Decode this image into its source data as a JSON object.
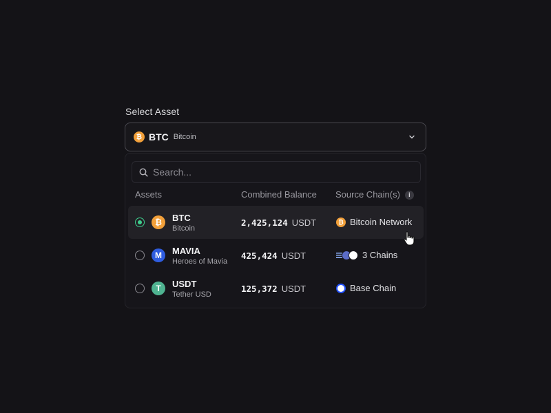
{
  "label": "Select Asset",
  "selected": {
    "symbol": "BTC",
    "name": "Bitcoin",
    "icon": "bitcoin-icon",
    "icon_glyph": "₿"
  },
  "search": {
    "placeholder": "Search..."
  },
  "columns": {
    "assets": "Assets",
    "balance": "Combined Balance",
    "chains": "Source Chain(s)",
    "info_glyph": "i"
  },
  "rows": [
    {
      "symbol": "BTC",
      "name": "Bitcoin",
      "glyph": "₿",
      "balance": "2,425,124",
      "unit": "USDT",
      "chain": "Bitcoin Network",
      "selected": true
    },
    {
      "symbol": "MAVIA",
      "name": "Heroes of Mavia",
      "glyph": "M",
      "balance": "425,424",
      "unit": "USDT",
      "chain": "3 Chains",
      "selected": false
    },
    {
      "symbol": "USDT",
      "name": "Tether USD",
      "glyph": "T",
      "balance": "125,372",
      "unit": "USDT",
      "chain": "Base Chain",
      "selected": false
    }
  ],
  "colors": {
    "accent_green": "#3fcf8e",
    "btc_orange": "#f2a03a",
    "mavia_blue": "#2f5de0",
    "usdt_green": "#4fb391",
    "base_blue": "#2352ff"
  }
}
